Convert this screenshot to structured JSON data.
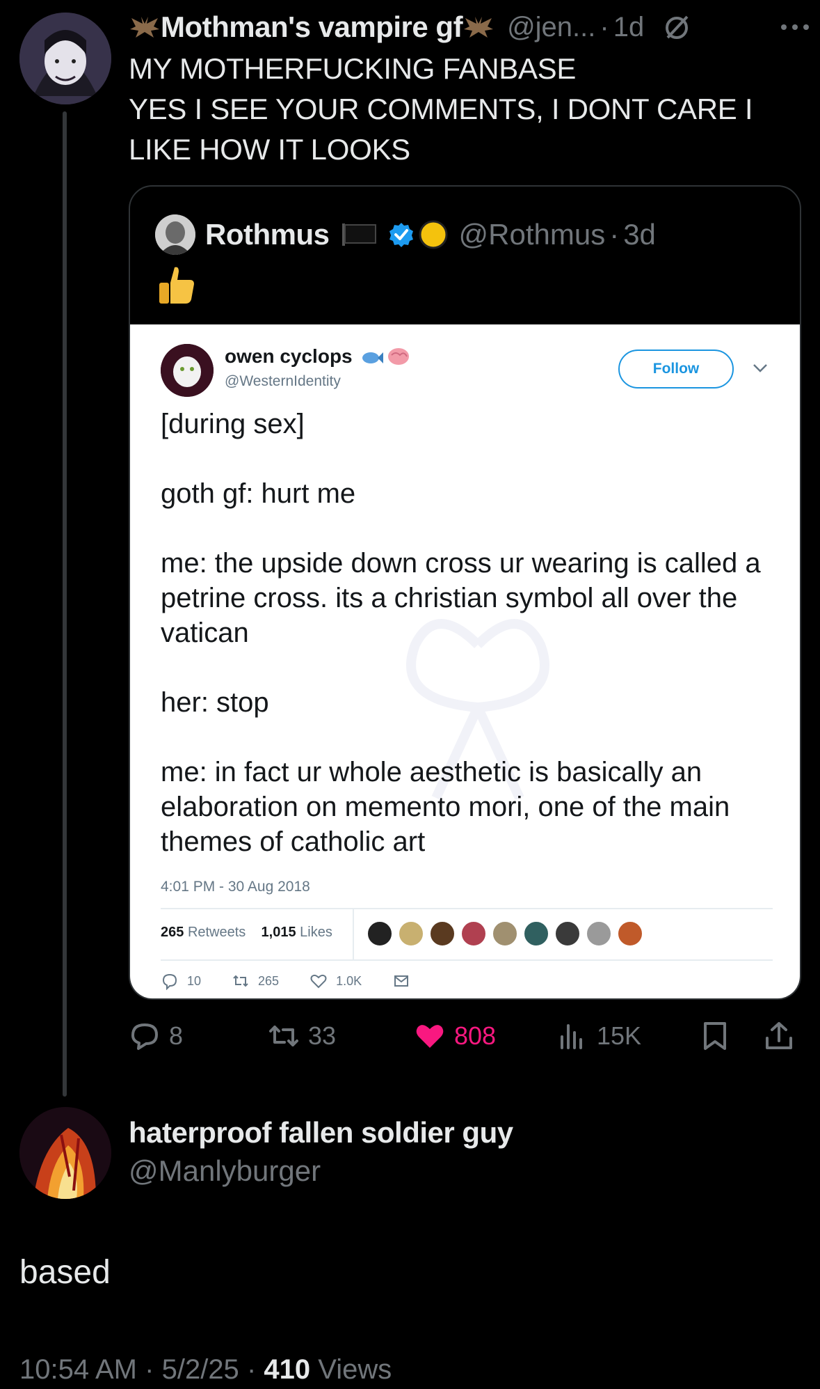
{
  "parent_tweet": {
    "display_name": "Mothman's vampire gf",
    "handle": "@jen...",
    "separator": "·",
    "time": "1d",
    "text": "MY MOTHERFUCKING FANBASE\nYES I SEE YOUR COMMENTS, I DONT CARE I LIKE HOW IT LOOKS",
    "icons": [
      "bat-emoji-icon",
      "muted-circle-icon",
      "more-options-icon"
    ]
  },
  "quoted_tweet": {
    "display_name": "Rothmus",
    "handle": "@Rothmus",
    "separator": "·",
    "time": "3d",
    "emoji": "thumbs-up-icon",
    "embedded_screenshot": {
      "display_name": "owen cyclops",
      "handle": "@WesternIdentity",
      "follow_label": "Follow",
      "body": [
        "[during sex]",
        "goth gf: hurt me",
        "me: the upside down cross ur wearing is called a petrine cross. its a christian symbol all over the vatican",
        "her: stop",
        "me: in fact ur whole aesthetic is basically an elaboration on memento mori, one of the main themes of catholic art"
      ],
      "timestamp": "4:01 PM - 30 Aug 2018",
      "retweets_count": "265",
      "retweets_label": "Retweets",
      "likes_count": "1,015",
      "likes_label": "Likes",
      "replies": "10",
      "retweets": "265",
      "likes": "1.0K"
    }
  },
  "actions": {
    "replies": "8",
    "reposts": "33",
    "likes": "808",
    "views": "15K"
  },
  "reply": {
    "display_name": "haterproof fallen soldier guy",
    "handle": "@Manlyburger",
    "text": "based",
    "time": "10:54 AM",
    "date": "5/2/25",
    "separator": "·",
    "views_count": "410",
    "views_label": "Views"
  },
  "colors": {
    "background": "#000000",
    "text_primary": "#e7e9ea",
    "text_secondary": "#71767b",
    "like_pink": "#f91880",
    "verified_blue": "#1d9bf0",
    "follow_blue": "#1b95e0"
  }
}
